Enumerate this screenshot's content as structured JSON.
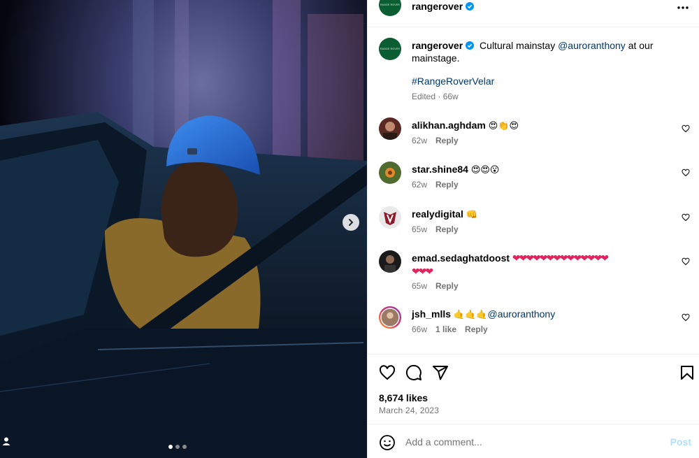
{
  "post": {
    "account": "rangerover",
    "brand_text": "RANGE ROVER",
    "caption": {
      "text_before": "Cultural mainstay ",
      "mention": "@auroranthony",
      "text_after": " at our mainstage.",
      "hashtag": "#RangeRoverVelar",
      "meta": "Edited · 66w"
    },
    "media": {
      "slide_current": 1,
      "slide_total": 3
    }
  },
  "comments": [
    {
      "username": "alikhan.aghdam",
      "text": "😍👏😍",
      "time": "62w",
      "reply": "Reply",
      "likes": ""
    },
    {
      "username": "star.shine84",
      "text": "😍😍😮",
      "time": "62w",
      "reply": "Reply",
      "likes": ""
    },
    {
      "username": "realydigital",
      "text": "👊",
      "time": "65w",
      "reply": "Reply",
      "likes": ""
    },
    {
      "username": "emad.sedaghatdoost",
      "text": "❤❤❤❤❤❤❤❤❤❤❤❤❤❤",
      "text2": "❤❤❤",
      "time": "65w",
      "reply": "Reply",
      "likes": ""
    },
    {
      "username": "jsh_mlls",
      "text": "🤙🤙🤙",
      "mention": "@auroranthony",
      "time": "66w",
      "reply": "Reply",
      "likes": "1 like"
    }
  ],
  "stats": {
    "likes": "8,674 likes",
    "date": "March 24, 2023"
  },
  "composer": {
    "placeholder": "Add a comment...",
    "post_label": "Post"
  },
  "colors": {
    "brand_green": "#0b5d32",
    "link": "#00376b",
    "verified": "#0095f6",
    "post_disabled": "#b2dffc",
    "secondary_text": "#737373"
  },
  "icons": {
    "like": "heart-icon",
    "comment": "comment-icon",
    "share": "send-icon",
    "save": "bookmark-icon",
    "emoji": "emoji-icon",
    "more": "more-icon",
    "next": "chevron-right-icon",
    "tag": "user-tag-icon"
  }
}
